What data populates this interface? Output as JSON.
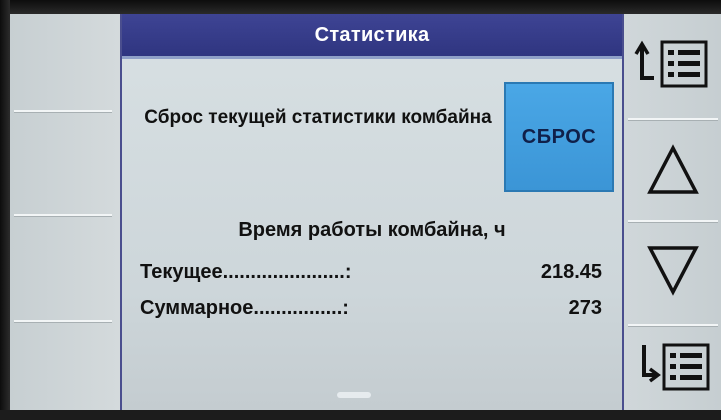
{
  "screen": {
    "title": "Статистика",
    "reset": {
      "label": "Сброс текущей статистики комбайна",
      "button_label": "СБРОС"
    },
    "work_time": {
      "heading": "Время работы комбайна, ч",
      "current_label": "Текущее......................:",
      "current_value": "218.45",
      "total_label": "Суммарное................:",
      "total_value": "273"
    }
  },
  "right_softkeys": [
    {
      "icon": "list-up-icon"
    },
    {
      "icon": "triangle-up-icon"
    },
    {
      "icon": "triangle-down-icon"
    },
    {
      "icon": "list-down-icon"
    }
  ],
  "colors": {
    "title_bar": "#353b88",
    "reset_button": "#3f9ddd",
    "background": "#cfd7da",
    "text": "#111111"
  }
}
